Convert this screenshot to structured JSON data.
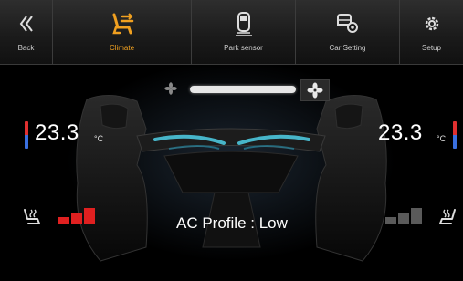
{
  "nav": {
    "items": [
      {
        "label": "Back",
        "icon": "chevron-double-left-icon"
      },
      {
        "label": "Climate",
        "icon": "climate-seat-airflow-icon",
        "active": true
      },
      {
        "label": "Park sensor",
        "icon": "park-sensor-icon"
      },
      {
        "label": "Car Setting",
        "icon": "car-gear-icon"
      },
      {
        "label": "Setup",
        "icon": "gear-icon"
      }
    ]
  },
  "climate": {
    "left_temp": "23.3",
    "right_temp": "23.3",
    "temp_unit": "°C",
    "fan_speed_fraction": 1.0,
    "left_seat_heat_level": 3,
    "right_seat_heat_level": 0,
    "seat_heat_max_level": 3,
    "ac_profile": "AC Profile : Low"
  },
  "colors": {
    "active_accent": "#f0a020",
    "heat_on": "#e02020",
    "heat_off": "#5a5a5a",
    "airflow": "#4fd0e8"
  }
}
